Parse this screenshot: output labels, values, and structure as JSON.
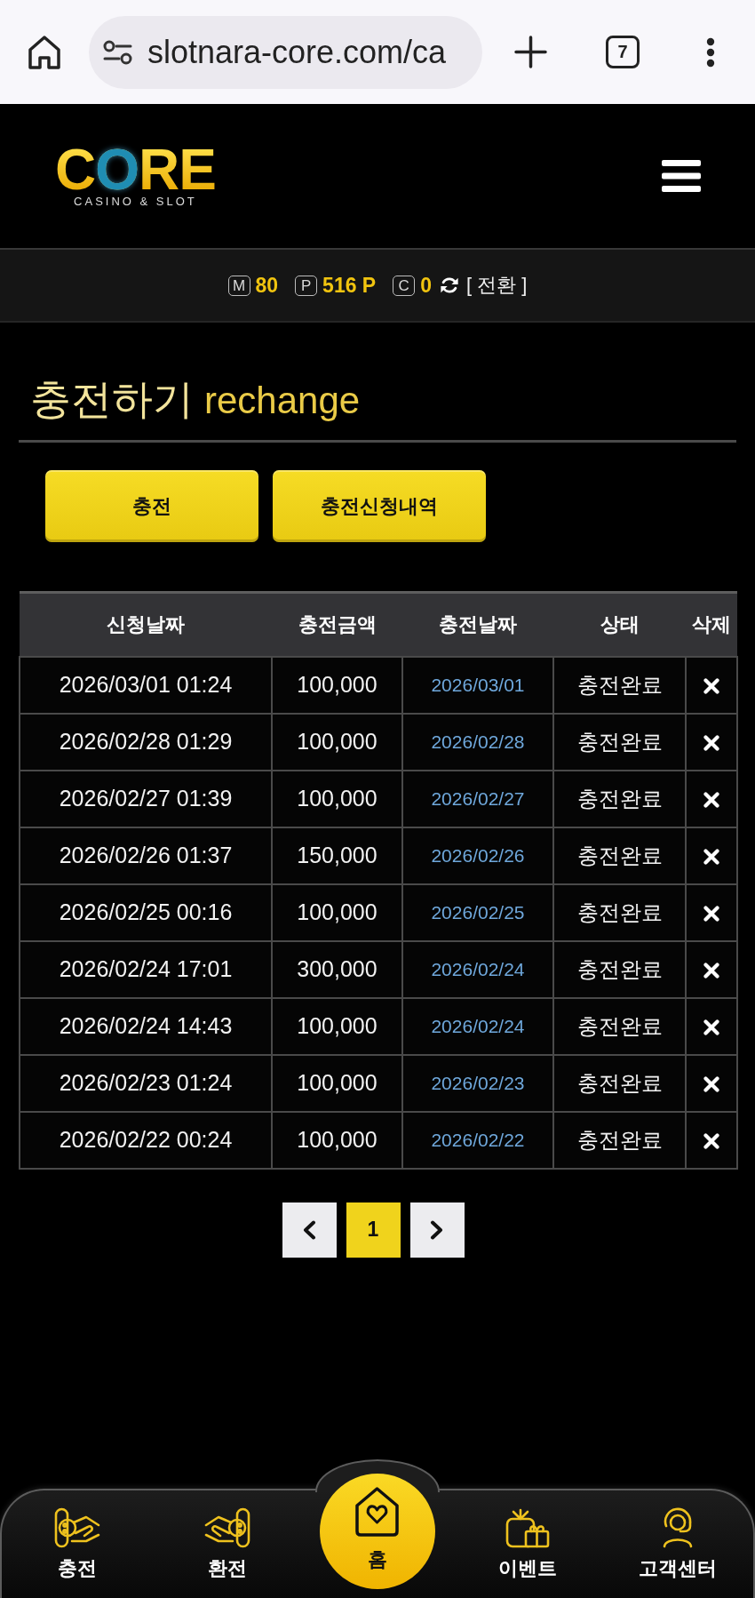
{
  "browser": {
    "url": "slotnara-core.com/ca",
    "tab_count": "7"
  },
  "header": {
    "logo": "CORE",
    "tagline": "CASINO & SLOT"
  },
  "balance_bar": {
    "items": [
      {
        "badge": "M",
        "value": "80"
      },
      {
        "badge": "P",
        "value": "516 P"
      },
      {
        "badge": "C",
        "value": "0"
      }
    ],
    "switch_label": "[ 전환 ]"
  },
  "page_title": {
    "main": "충전하기",
    "sub": "rechange"
  },
  "buttons": [
    "충전",
    "충전신청내역"
  ],
  "table": {
    "columns": [
      "신청날짜",
      "충전금액",
      "충전날짜",
      "상태",
      "삭제"
    ],
    "rows": [
      {
        "requested_at": "2026/03/01 01:24",
        "amount": "100,000",
        "charged_on": "2026/03/01",
        "status": "충전완료"
      },
      {
        "requested_at": "2026/02/28 01:29",
        "amount": "100,000",
        "charged_on": "2026/02/28",
        "status": "충전완료"
      },
      {
        "requested_at": "2026/02/27 01:39",
        "amount": "100,000",
        "charged_on": "2026/02/27",
        "status": "충전완료"
      },
      {
        "requested_at": "2026/02/26 01:37",
        "amount": "150,000",
        "charged_on": "2026/02/26",
        "status": "충전완료"
      },
      {
        "requested_at": "2026/02/25 00:16",
        "amount": "100,000",
        "charged_on": "2026/02/25",
        "status": "충전완료"
      },
      {
        "requested_at": "2026/02/24 17:01",
        "amount": "300,000",
        "charged_on": "2026/02/24",
        "status": "충전완료"
      },
      {
        "requested_at": "2026/02/24 14:43",
        "amount": "100,000",
        "charged_on": "2026/02/24",
        "status": "충전완료"
      },
      {
        "requested_at": "2026/02/23 01:24",
        "amount": "100,000",
        "charged_on": "2026/02/23",
        "status": "충전완료"
      },
      {
        "requested_at": "2026/02/22 00:24",
        "amount": "100,000",
        "charged_on": "2026/02/22",
        "status": "충전완료"
      }
    ]
  },
  "pagination": {
    "pages": [
      {
        "label": "1",
        "selected": true
      }
    ]
  },
  "bottom_nav": {
    "items": [
      {
        "kind": "deposit",
        "label": "충전"
      },
      {
        "kind": "withdraw",
        "label": "환전"
      },
      {
        "kind": "home",
        "label": "홈"
      },
      {
        "kind": "event",
        "label": "이벤트"
      },
      {
        "kind": "support",
        "label": "고객센터"
      }
    ]
  }
}
